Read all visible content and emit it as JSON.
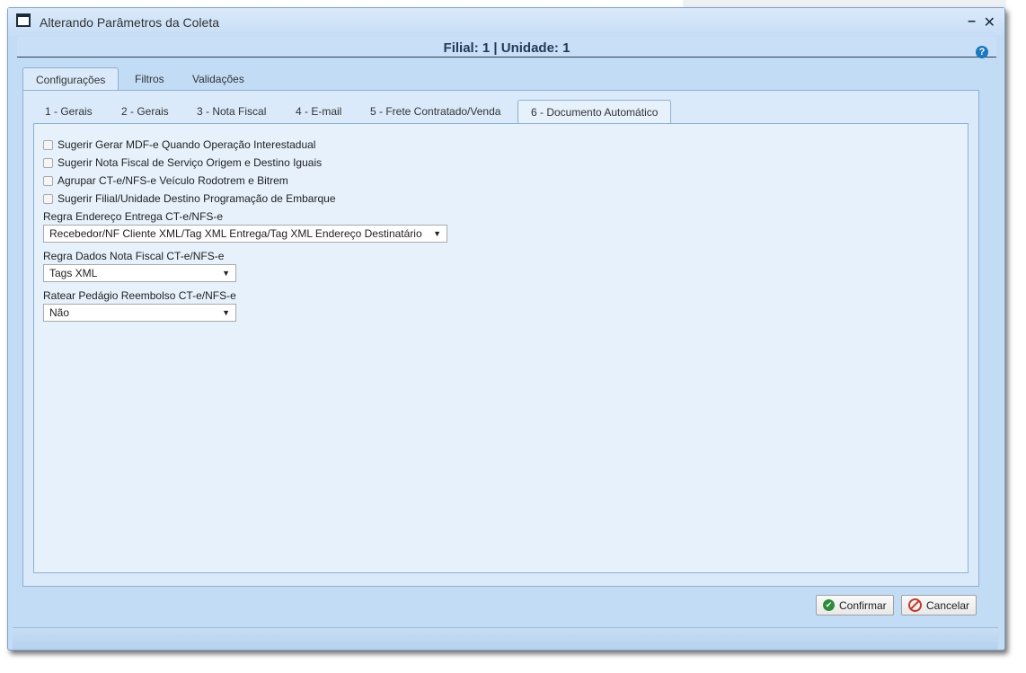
{
  "window": {
    "title": "Alterando Parâmetros da Coleta"
  },
  "header": {
    "subtitle": "Filial: 1 | Unidade: 1"
  },
  "outer_tabs": [
    "Configurações",
    "Filtros",
    "Validações"
  ],
  "inner_tabs": [
    "1 - Gerais",
    "2 - Gerais",
    "3 - Nota Fiscal",
    "4 - E-mail",
    "5 - Frete Contratado/Venda",
    "6 - Documento Automático"
  ],
  "checkboxes": [
    {
      "label": "Sugerir Gerar MDF-e Quando Operação Interestadual",
      "checked": false
    },
    {
      "label": "Sugerir Nota Fiscal de Serviço Origem e Destino Iguais",
      "checked": false
    },
    {
      "label": "Agrupar CT-e/NFS-e Veículo Rodotrem e Bitrem",
      "checked": false
    },
    {
      "label": "Sugerir Filial/Unidade Destino Programação de Embarque",
      "checked": false
    }
  ],
  "fields": {
    "endereco": {
      "label": "Regra Endereço Entrega CT-e/NFS-e",
      "value": "Recebedor/NF Cliente XML/Tag XML Entrega/Tag XML Endereço Destinatário"
    },
    "dados_nf": {
      "label": "Regra Dados Nota Fiscal CT-e/NFS-e",
      "value": "Tags XML"
    },
    "pedagio": {
      "label": "Ratear Pedágio Reembolso CT-e/NFS-e",
      "value": "Não"
    }
  },
  "buttons": {
    "confirm": "Confirmar",
    "cancel": "Cancelar"
  },
  "icons": {
    "arrow": "▼",
    "help": "?",
    "minimize": "–",
    "close": "✕",
    "check": "✔"
  },
  "colors": {
    "window_bg": "#c3dcf6",
    "panel_bg": "#e6f1fc",
    "title_text": "#223a59"
  }
}
